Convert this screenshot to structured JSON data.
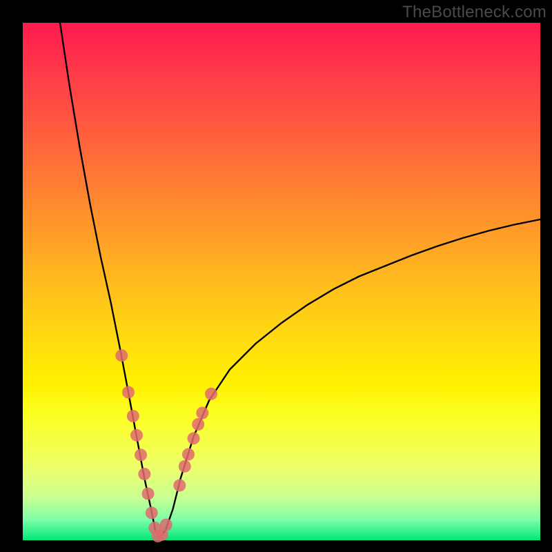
{
  "watermark": "TheBottleneck.com",
  "colors": {
    "frame": "#000000",
    "gradient_top": "#ff1a4e",
    "gradient_bottom": "#00e676",
    "curve": "#000000",
    "marker_fill": "#e06a6f",
    "marker_stroke": "#c14f55"
  },
  "chart_data": {
    "type": "line",
    "title": "",
    "xlabel": "",
    "ylabel": "",
    "xlim": [
      0,
      100
    ],
    "ylim": [
      0,
      100
    ],
    "note": "Axes are unlabeled; x is a normalized horizontal position (0=left,100=right) and y is a normalized vertical value (0=bottom,100=top). The curve is a V/absolute-value-like function with minimum near x≈26, y≈0. Left branch rises steeply to y≈100 at x≈7; right branch rises shallowly to y≈62 at x≈100.",
    "series": [
      {
        "name": "curve",
        "x": [
          7.2,
          9,
          11,
          13,
          15,
          17,
          19,
          20.5,
          22,
          23.5,
          24.8,
          25.6,
          26.4,
          27.6,
          29,
          30.5,
          33,
          36,
          40,
          45,
          50,
          55,
          60,
          65,
          70,
          75,
          80,
          85,
          90,
          95,
          100
        ],
        "y": [
          100,
          88,
          76,
          65,
          55,
          46,
          36,
          28,
          20,
          12,
          6,
          2,
          0.5,
          2,
          6,
          12,
          20,
          27,
          33,
          38,
          42,
          45.5,
          48.5,
          51,
          53,
          55,
          56.8,
          58.4,
          59.8,
          61,
          62
        ]
      }
    ],
    "markers": {
      "name": "highlighted-points",
      "note": "Pink dots clustered around the curve minimum on both branches (roughly lower 35% of the plot height).",
      "x": [
        19.1,
        20.4,
        21.3,
        22.0,
        22.8,
        23.5,
        24.2,
        24.9,
        25.5,
        26.1,
        26.9,
        27.7,
        30.3,
        31.3,
        32.0,
        33.0,
        33.9,
        34.7,
        36.4
      ],
      "y": [
        35.7,
        28.6,
        24.0,
        20.3,
        16.5,
        12.8,
        9.0,
        5.3,
        2.4,
        0.8,
        1.1,
        3.0,
        10.6,
        14.3,
        16.6,
        19.7,
        22.4,
        24.6,
        28.3
      ]
    }
  }
}
